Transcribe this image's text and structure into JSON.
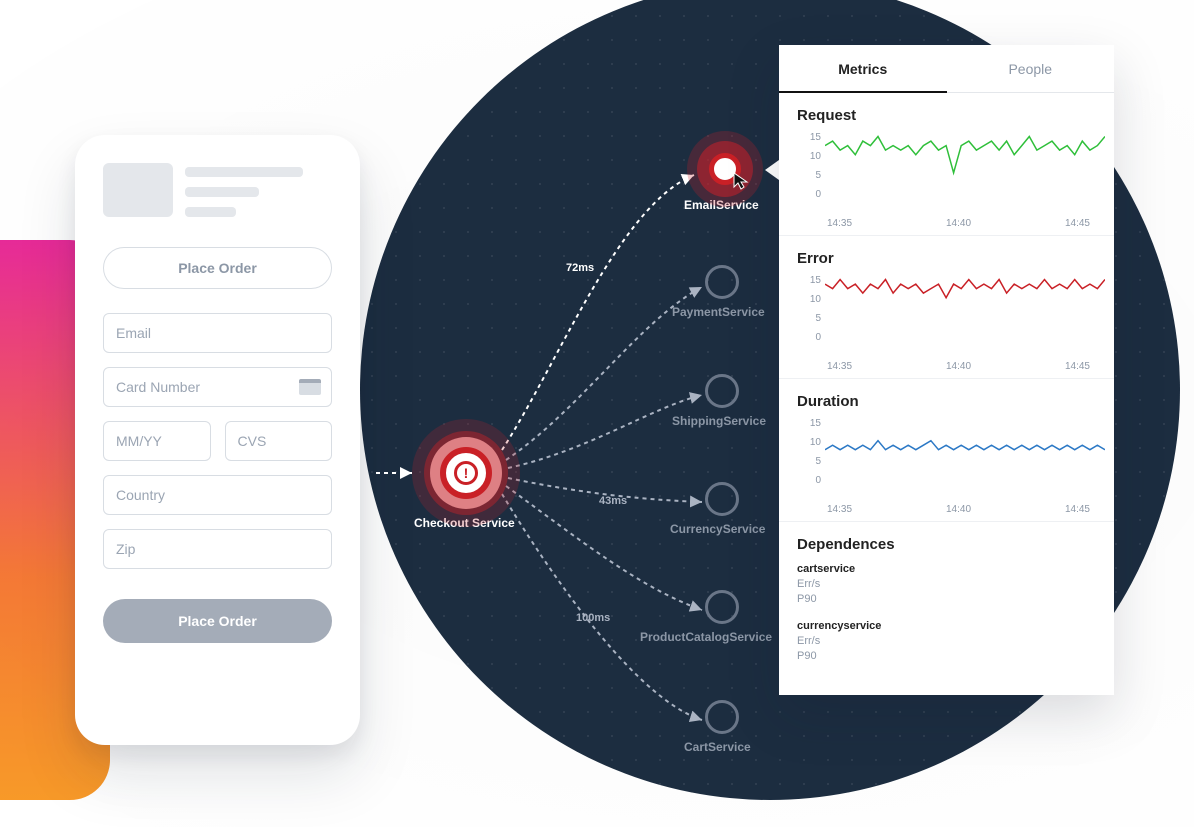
{
  "checkout": {
    "placeOrderOutlineLabel": "Place Order",
    "placeOrderFilledLabel": "Place Order",
    "fields": {
      "email": "Email",
      "card": "Card Number",
      "expiry": "MM/YY",
      "cvs": "CVS",
      "country": "Country",
      "zip": "Zip"
    }
  },
  "topology": {
    "rootLabel": "Checkout Service",
    "services": {
      "email": "EmailService",
      "payment": "PaymentService",
      "shipping": "ShippingService",
      "currency": "CurrencyService",
      "catalog": "ProductCatalogService",
      "cart": "CartService"
    },
    "edges": {
      "email_ms": "72ms",
      "currency_ms": "43ms",
      "catalog_ms": "100ms"
    }
  },
  "panel": {
    "tabs": {
      "metrics": "Metrics",
      "people": "People"
    },
    "sections": {
      "request": "Request",
      "error": "Error",
      "duration": "Duration",
      "dependences": "Dependences"
    },
    "yticks": [
      "15",
      "10",
      "5",
      "0"
    ],
    "xticks": [
      "14:35",
      "14:40",
      "14:45"
    ],
    "deps": [
      {
        "name": "cartservice",
        "rows": [
          "Err/s",
          "P90"
        ]
      },
      {
        "name": "currencyservice",
        "rows": [
          "Err/s",
          "P90"
        ]
      }
    ]
  },
  "chart_data": [
    {
      "type": "line",
      "title": "Request",
      "ylim": [
        0,
        15
      ],
      "yticks": [
        0,
        5,
        10,
        15
      ],
      "xticks": [
        "14:35",
        "14:40",
        "14:45"
      ],
      "x_range_minutes": [
        14.583,
        14.783
      ],
      "series": [
        {
          "name": "Request",
          "color": "#2fbf3a",
          "values": [
            12,
            13,
            11,
            12,
            10,
            13,
            12,
            14,
            11,
            12,
            11,
            12,
            10,
            12,
            13,
            11,
            12,
            6,
            12,
            13,
            11,
            12,
            13,
            11,
            13,
            10,
            12,
            14,
            11,
            12,
            13,
            11,
            12,
            10,
            13,
            11,
            12,
            14
          ]
        }
      ]
    },
    {
      "type": "line",
      "title": "Error",
      "ylim": [
        0,
        15
      ],
      "yticks": [
        0,
        5,
        10,
        15
      ],
      "xticks": [
        "14:35",
        "14:40",
        "14:45"
      ],
      "x_range_minutes": [
        14.583,
        14.783
      ],
      "series": [
        {
          "name": "Error",
          "color": "#c92026",
          "values": [
            13,
            12,
            14,
            12,
            13,
            11,
            13,
            12,
            14,
            11,
            13,
            12,
            13,
            11,
            12,
            13,
            10,
            13,
            12,
            14,
            12,
            13,
            12,
            14,
            11,
            13,
            12,
            13,
            12,
            14,
            12,
            13,
            12,
            14,
            12,
            13,
            12,
            14
          ]
        }
      ]
    },
    {
      "type": "line",
      "title": "Duration",
      "ylim": [
        0,
        15
      ],
      "yticks": [
        0,
        5,
        10,
        15
      ],
      "xticks": [
        "14:35",
        "14:40",
        "14:45"
      ],
      "x_range_minutes": [
        14.583,
        14.783
      ],
      "series": [
        {
          "name": "Duration",
          "color": "#2b78c5",
          "values": [
            8,
            9,
            8,
            9,
            8,
            9,
            8,
            10,
            8,
            9,
            8,
            9,
            8,
            9,
            10,
            8,
            9,
            8,
            9,
            8,
            9,
            8,
            9,
            8,
            9,
            8,
            9,
            8,
            9,
            8,
            9,
            8,
            9,
            8,
            9,
            8,
            9,
            8
          ]
        }
      ]
    }
  ],
  "colors": {
    "accentRed": "#c92026",
    "green": "#2fbf3a",
    "blue": "#2b78c5",
    "darkNavy": "#1c2d40",
    "mutedGray": "#8c97a6"
  }
}
